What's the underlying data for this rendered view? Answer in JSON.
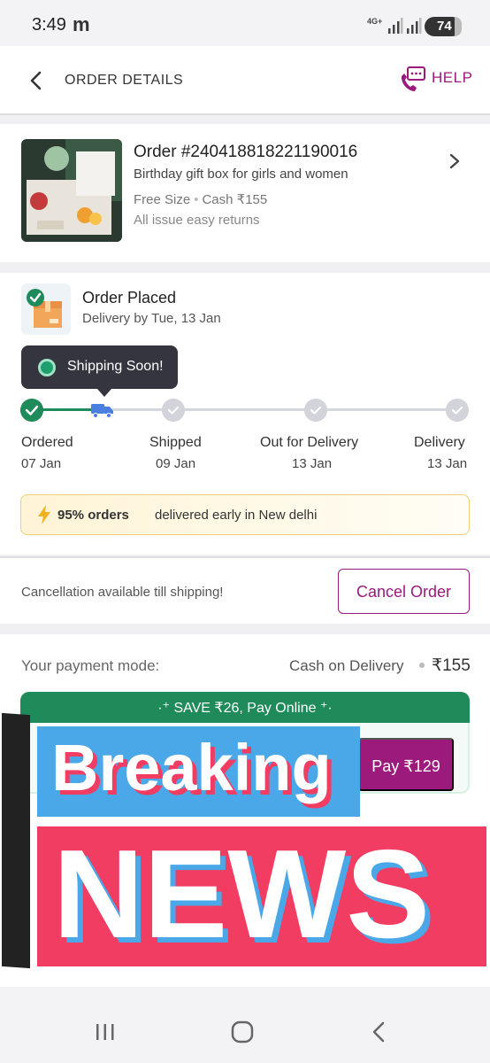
{
  "status_bar": {
    "time": "3:49",
    "carrier_icon": "m",
    "network": "4G+",
    "battery": "74"
  },
  "header": {
    "title": "ORDER DETAILS",
    "help_label": "HELP"
  },
  "product": {
    "order_id": "Order #240418818221190016",
    "name": "Birthday gift box for girls and women",
    "size": "Free Size",
    "payment": "Cash ₹155",
    "returns": "All issue easy returns"
  },
  "status": {
    "title": "Order Placed",
    "delivery": "Delivery by  Tue, 13 Jan",
    "tooltip": "Shipping Soon!",
    "steps": [
      {
        "label": "Ordered",
        "date": "07 Jan"
      },
      {
        "label": "Shipped",
        "date": "09 Jan"
      },
      {
        "label": "Out for Delivery",
        "date": "13 Jan"
      },
      {
        "label": "Delivery",
        "date": "13 Jan"
      }
    ],
    "promo_bold": "95% orders",
    "promo_text": "delivered early in New delhi"
  },
  "cancel": {
    "note": "Cancellation available till shipping!",
    "button": "Cancel Order"
  },
  "payment": {
    "label": "Your payment mode:",
    "mode": "Cash on Delivery",
    "amount": "₹155",
    "save_banner": "·⁺ SAVE ₹26, Pay Online ⁺·",
    "pay_online": "Pay ₹129"
  },
  "overlay": {
    "line1": "Breaking",
    "line2": "NEWS"
  },
  "colors": {
    "brand": "#9c1a7c",
    "success": "#1f8a5a",
    "news_red": "#f23d63",
    "news_blue": "#4aa8e8"
  }
}
